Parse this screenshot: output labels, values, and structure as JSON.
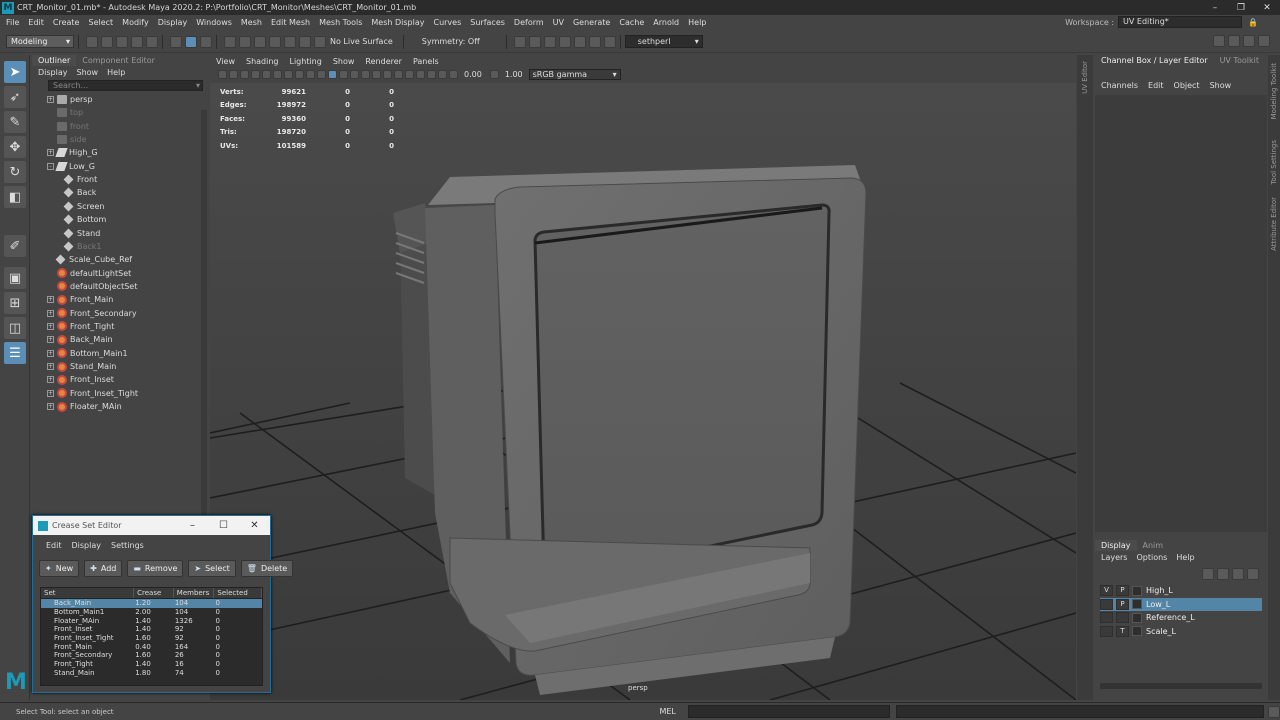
{
  "window": {
    "title": "CRT_Monitor_01.mb* - Autodesk Maya 2020.2: P:\\Portfolio\\CRT_Monitor\\Meshes\\CRT_Monitor_01.mb",
    "logo_letter": "M"
  },
  "menu": [
    "File",
    "Edit",
    "Create",
    "Select",
    "Modify",
    "Display",
    "Windows",
    "Mesh",
    "Edit Mesh",
    "Mesh Tools",
    "Mesh Display",
    "Curves",
    "Surfaces",
    "Deform",
    "UV",
    "Generate",
    "Cache",
    "Arnold",
    "Help"
  ],
  "workspace": {
    "label": "Workspace :",
    "value": "UV Editing*"
  },
  "status_line": {
    "mode": "Modeling",
    "live_surface": "No Live Surface",
    "symmetry": "Symmetry: Off",
    "user": "sethperl"
  },
  "outliner": {
    "tabs": [
      "Outliner",
      "Component Editor"
    ],
    "menu": [
      "Display",
      "Show",
      "Help"
    ],
    "search_placeholder": "Search...",
    "items": [
      {
        "label": "persp",
        "type": "cam",
        "indent": 1,
        "expander": "+",
        "dim": false
      },
      {
        "label": "top",
        "type": "cam",
        "indent": 1,
        "expander": "",
        "dim": true
      },
      {
        "label": "front",
        "type": "cam",
        "indent": 1,
        "expander": "",
        "dim": true
      },
      {
        "label": "side",
        "type": "cam",
        "indent": 1,
        "expander": "",
        "dim": true
      },
      {
        "label": "High_G",
        "type": "grp",
        "indent": 1,
        "expander": "+",
        "dim": false
      },
      {
        "label": "Low_G",
        "type": "grp",
        "indent": 1,
        "expander": "-",
        "dim": false
      },
      {
        "label": "Front",
        "type": "mesh",
        "indent": 2,
        "expander": "",
        "dim": false
      },
      {
        "label": "Back",
        "type": "mesh",
        "indent": 2,
        "expander": "",
        "dim": false
      },
      {
        "label": "Screen",
        "type": "mesh",
        "indent": 2,
        "expander": "",
        "dim": false
      },
      {
        "label": "Bottom",
        "type": "mesh",
        "indent": 2,
        "expander": "",
        "dim": false
      },
      {
        "label": "Stand",
        "type": "mesh",
        "indent": 2,
        "expander": "",
        "dim": false
      },
      {
        "label": "Back1",
        "type": "mesh",
        "indent": 2,
        "expander": "",
        "dim": true
      },
      {
        "label": "Scale_Cube_Ref",
        "type": "mesh",
        "indent": 1,
        "expander": "",
        "dim": false
      },
      {
        "label": "defaultLightSet",
        "type": "set",
        "indent": 1,
        "expander": "",
        "dim": false
      },
      {
        "label": "defaultObjectSet",
        "type": "set",
        "indent": 1,
        "expander": "",
        "dim": false
      },
      {
        "label": "Front_Main",
        "type": "set",
        "indent": 1,
        "expander": "+",
        "dim": false
      },
      {
        "label": "Front_Secondary",
        "type": "set",
        "indent": 1,
        "expander": "+",
        "dim": false
      },
      {
        "label": "Front_Tight",
        "type": "set",
        "indent": 1,
        "expander": "+",
        "dim": false
      },
      {
        "label": "Back_Main",
        "type": "set",
        "indent": 1,
        "expander": "+",
        "dim": false
      },
      {
        "label": "Bottom_Main1",
        "type": "set",
        "indent": 1,
        "expander": "+",
        "dim": false
      },
      {
        "label": "Stand_Main",
        "type": "set",
        "indent": 1,
        "expander": "+",
        "dim": false
      },
      {
        "label": "Front_Inset",
        "type": "set",
        "indent": 1,
        "expander": "+",
        "dim": false
      },
      {
        "label": "Front_Inset_Tight",
        "type": "set",
        "indent": 1,
        "expander": "+",
        "dim": false
      },
      {
        "label": "Floater_MAin",
        "type": "set",
        "indent": 1,
        "expander": "+",
        "dim": false
      }
    ]
  },
  "viewport": {
    "menu": [
      "View",
      "Shading",
      "Lighting",
      "Show",
      "Renderer",
      "Panels"
    ],
    "exposure": "0.00",
    "gamma": "1.00",
    "color_space": "sRGB gamma",
    "camera_label": "persp",
    "hud": [
      {
        "label": "Verts:",
        "a": "99621",
        "b": "0",
        "c": "0"
      },
      {
        "label": "Edges:",
        "a": "198972",
        "b": "0",
        "c": "0"
      },
      {
        "label": "Faces:",
        "a": "99360",
        "b": "0",
        "c": "0"
      },
      {
        "label": "Tris:",
        "a": "198720",
        "b": "0",
        "c": "0"
      },
      {
        "label": "UVs:",
        "a": "101589",
        "b": "0",
        "c": "0"
      }
    ]
  },
  "side_strips": {
    "uv_editor": "UV Editor",
    "right": [
      "Modeling Toolkit",
      "Tool Settings",
      "Attribute Editor"
    ]
  },
  "channel_box": {
    "tabs": [
      "Channel Box / Layer Editor",
      "UV Toolkit"
    ],
    "menu": [
      "Channels",
      "Edit",
      "Object",
      "Show"
    ]
  },
  "layer_editor": {
    "tabs": [
      "Display",
      "Anim"
    ],
    "menu": [
      "Layers",
      "Options",
      "Help"
    ],
    "layers": [
      {
        "v": "V",
        "p": "P",
        "name": "High_L",
        "selected": false
      },
      {
        "v": "",
        "p": "P",
        "name": "Low_L",
        "selected": true
      },
      {
        "v": "",
        "p": "",
        "name": "Reference_L",
        "selected": false
      },
      {
        "v": "",
        "p": "T",
        "name": "Scale_L",
        "selected": false
      }
    ]
  },
  "crease_editor": {
    "title": "Crease Set Editor",
    "menu": [
      "Edit",
      "Display",
      "Settings"
    ],
    "buttons": [
      "New",
      "Add",
      "Remove",
      "Select",
      "Delete"
    ],
    "columns": [
      "Set",
      "Crease",
      "Members",
      "Selected"
    ],
    "rows": [
      {
        "set": "Back_Main",
        "crease": "1.20",
        "members": "104",
        "selected": "0",
        "highlight": true
      },
      {
        "set": "Bottom_Main1",
        "crease": "2.00",
        "members": "104",
        "selected": "0",
        "highlight": false
      },
      {
        "set": "Floater_MAin",
        "crease": "1.40",
        "members": "1326",
        "selected": "0",
        "highlight": false
      },
      {
        "set": "Front_Inset",
        "crease": "1.40",
        "members": "92",
        "selected": "0",
        "highlight": false
      },
      {
        "set": "Front_Inset_Tight",
        "crease": "1.60",
        "members": "92",
        "selected": "0",
        "highlight": false
      },
      {
        "set": "Front_Main",
        "crease": "0.40",
        "members": "164",
        "selected": "0",
        "highlight": false
      },
      {
        "set": "Front_Secondary",
        "crease": "1.60",
        "members": "26",
        "selected": "0",
        "highlight": false
      },
      {
        "set": "Front_Tight",
        "crease": "1.40",
        "members": "16",
        "selected": "0",
        "highlight": false
      },
      {
        "set": "Stand_Main",
        "crease": "1.80",
        "members": "74",
        "selected": "0",
        "highlight": false
      }
    ]
  },
  "command_line": {
    "help": "Select Tool: select an object",
    "mel": "MEL"
  }
}
